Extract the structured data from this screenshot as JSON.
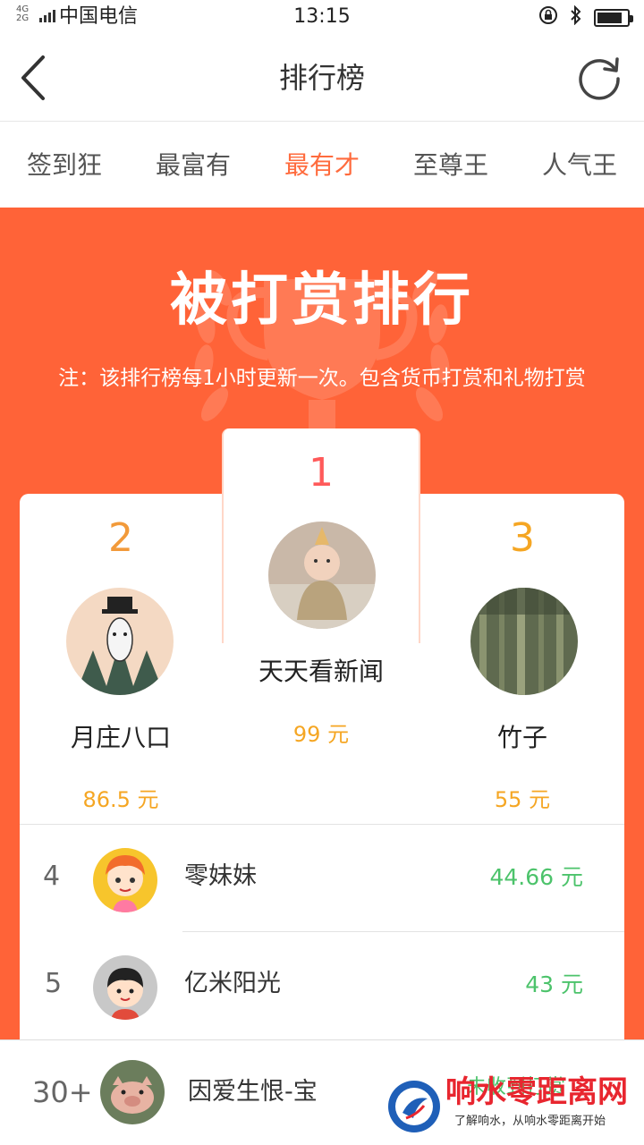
{
  "status_bar": {
    "network": "4G 2G",
    "carrier": "中国电信",
    "time": "13:15"
  },
  "nav": {
    "title": "排行榜"
  },
  "tabs": [
    {
      "label": "签到狂",
      "active": false
    },
    {
      "label": "最富有",
      "active": false
    },
    {
      "label": "最有才",
      "active": true
    },
    {
      "label": "至尊王",
      "active": false
    },
    {
      "label": "人气王",
      "active": false
    }
  ],
  "banner": {
    "title": "被打赏排行",
    "note": "注：该排行榜每1小时更新一次。包含货币打赏和礼物打赏"
  },
  "podium": {
    "first": {
      "rank": "1",
      "name": "天天看新闻",
      "amount": "99 元"
    },
    "second": {
      "rank": "2",
      "name": "月庄八口",
      "amount": "86.5 元"
    },
    "third": {
      "rank": "3",
      "name": "竹子",
      "amount": "55 元"
    }
  },
  "list": [
    {
      "rank": "4",
      "name": "零妹妹",
      "amount": "44.66 元"
    },
    {
      "rank": "5",
      "name": "亿米阳光",
      "amount": "43 元"
    }
  ],
  "my_rank": {
    "rank": "30+",
    "name": "因爱生恨-宝",
    "status": "未收到打赏"
  },
  "watermark": {
    "title": "响水零距离网",
    "subtitle": "了解响水，从响水零距离开始"
  },
  "colors": {
    "accent": "#ff6338",
    "tab_active": "#ff6b3d",
    "rank_gold": "#f5a623",
    "amount_green": "#4cc36b",
    "first_number": "#ff5a5a"
  }
}
